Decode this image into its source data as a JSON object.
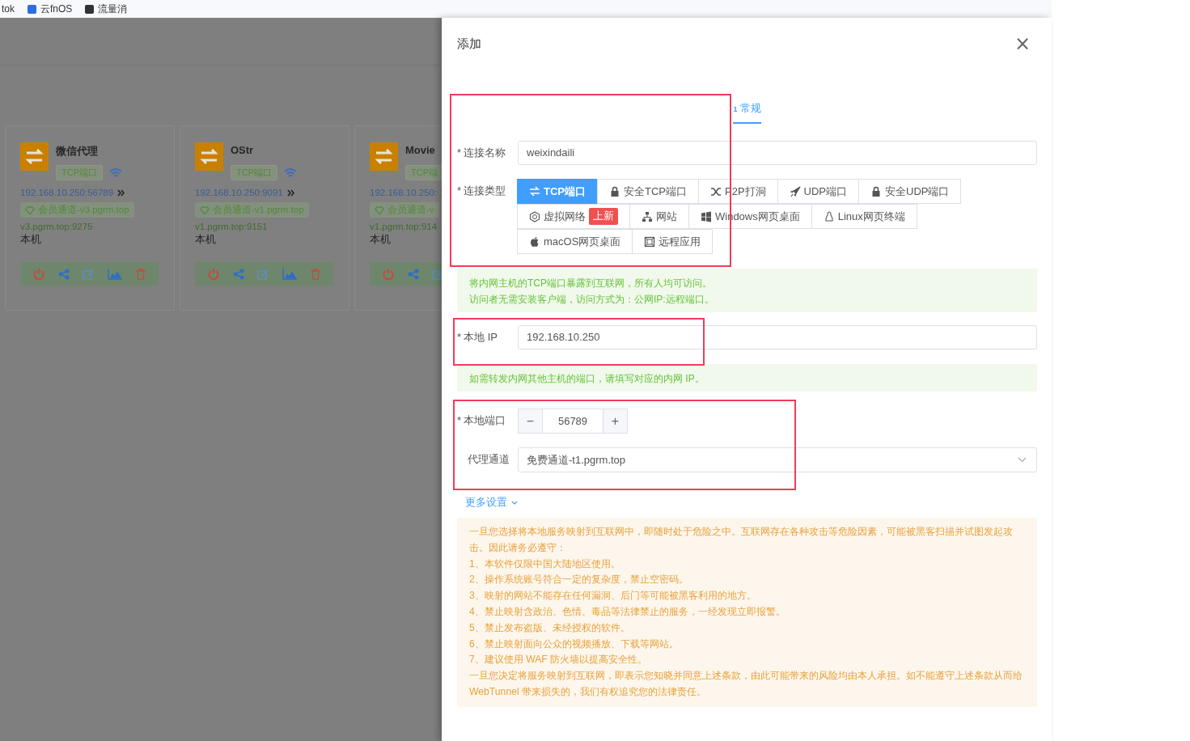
{
  "bookmarks": [
    {
      "label": "tok"
    },
    {
      "label": "云fnOS"
    },
    {
      "label": "流量消"
    }
  ],
  "cards": [
    {
      "name": "微信代理",
      "type_tag": "TCP端口",
      "local_address": "192.168.10.250:56789",
      "channel": "会员通道-v3.pgrm.top",
      "remote_address": "v3.pgrm.top:9275",
      "host": "本机"
    },
    {
      "name": "OStr",
      "type_tag": "TCP端口",
      "local_address": "192.168.10.250:9091",
      "channel": "会员通道-v1.pgrm.top",
      "remote_address": "v1.pgrm.top:9151",
      "host": "本机"
    },
    {
      "name": "Movie",
      "type_tag": "TCP端",
      "local_address": "192.168.10.250:",
      "channel": "会员通道-v",
      "remote_address": "v1.pgrm.top:914",
      "host": "本机"
    }
  ],
  "drawer": {
    "title": "添加",
    "close": "×",
    "steps": [
      {
        "number": "1",
        "label": "常规",
        "selected": true
      }
    ],
    "name_field": {
      "label": "连接名称",
      "required_mark": "*",
      "value": "weixindaili"
    },
    "type_field": {
      "label": "连接类型",
      "required_mark": "*",
      "rows": [
        {
          "options": [
            {
              "label": "TCP端口",
              "selected": true
            },
            {
              "label": "安全TCP端口",
              "selected": false
            },
            {
              "label": "P2P打洞",
              "selected": false
            },
            {
              "label": "UDP端口",
              "selected": false
            },
            {
              "label": "安全UDP端口",
              "selected": false
            }
          ]
        },
        {
          "options": [
            {
              "label": "虚拟网络",
              "badge": "上新",
              "selected": false
            },
            {
              "label": "网站",
              "selected": false
            },
            {
              "label": "Windows网页桌面",
              "selected": false
            },
            {
              "label": "Linux网页终端",
              "selected": false
            }
          ]
        },
        {
          "options": [
            {
              "label": "macOS网页桌面",
              "selected": false
            },
            {
              "label": "远程应用",
              "selected": false
            }
          ]
        }
      ]
    },
    "type_hint": [
      "将内网主机的TCP端口暴露到互联网，所有人均可访问。",
      "访问者无需安装客户端，访问方式为：公网IP:远程端口。"
    ],
    "ip_field": {
      "label": "本地 IP",
      "required_mark": "*",
      "value": "192.168.10.250"
    },
    "ip_hint": [
      "如需转发内网其他主机的端口，请填写对应的内网 IP。"
    ],
    "port_field": {
      "label": "本地端口",
      "required_mark": "*",
      "minus": "−",
      "value": "56789",
      "plus": "+"
    },
    "proxy_field": {
      "label": "代理通道",
      "value": "免费通道-t1.pgrm.top"
    },
    "more_settings": "更多设置",
    "warning": [
      "一旦您选择将本地服务映射到互联网中，即随时处于危险之中。互联网存在各种攻击等危险因素，可能被黑客扫描并试图发起攻击。因此请务必遵守：",
      "1、本软件仅限中国大陆地区使用。",
      "2、操作系统账号符合一定的复杂度，禁止空密码。",
      "3、映射的网站不能存在任何漏洞、后门等可能被黑客利用的地方。",
      "4、禁止映射含政治、色情、毒品等法律禁止的服务，一经发现立即报警。",
      "5、禁止发布盗版、未经授权的软件。",
      "6、禁止映射面向公众的视频播放、下载等网站。",
      "7、建议使用 WAF 防火墙以提高安全性。",
      "一旦您决定将服务映射到互联网，即表示您知晓并同意上述条款，由此可能带来的风险均由本人承担。如不能遵守上述条款从而给 WebTunnel 带来损失的，我们有权追究您的法律责任。"
    ]
  }
}
